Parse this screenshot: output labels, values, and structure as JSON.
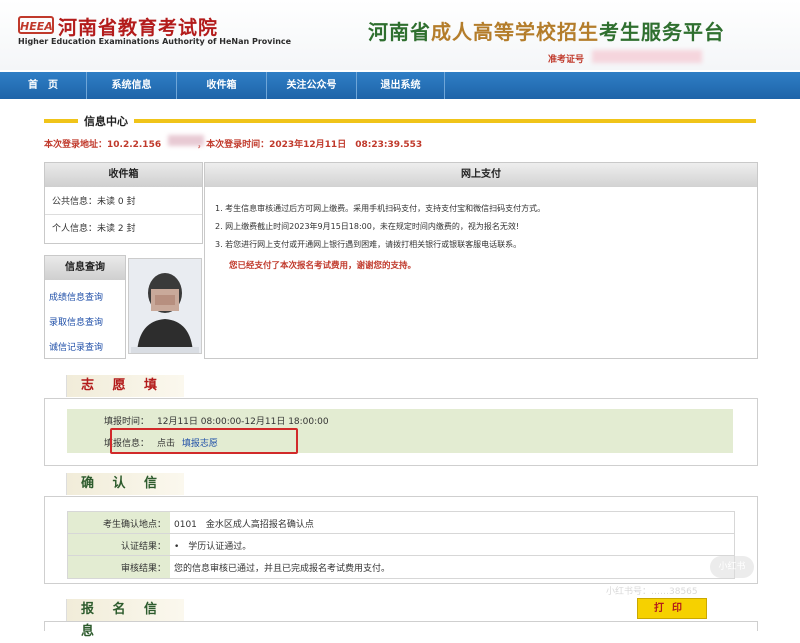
{
  "header": {
    "logo_text": "HEEA",
    "org_name": "河南省教育考试院",
    "org_name_en": "Higher Education Examinations Authority of HeNan Province",
    "platform_title_a": "河南省",
    "platform_title_b": "成人高等学校招生",
    "platform_title_c": "考生服务平台",
    "ticket_label": "准考证号"
  },
  "nav": {
    "items": [
      "首　页",
      "系统信息",
      "收件箱",
      "关注公众号",
      "退出系统"
    ]
  },
  "info_center": {
    "title": "信息中心",
    "login_line": "本次登录地址：10.2.2.156　　　　，本次登录时间：2023年12月11日　08:23:39.553"
  },
  "inbox": {
    "title": "收件箱",
    "public": "公共信息：未读 0 封",
    "personal": "个人信息：未读 2 封"
  },
  "query": {
    "title": "信息查询",
    "links": [
      "成绩信息查询",
      "录取信息查询",
      "诚信记录查询"
    ]
  },
  "payment": {
    "title": "网上支付",
    "lines": [
      "1.  考生信息审核通过后方可网上缴费。采用手机扫码支付，支持支付宝和微信扫码支付方式。",
      "2.  网上缴费截止时间2023年9月15日18:00，未在规定时间内缴费的，视为报名无效!",
      "3.  若您进行网上支付或开通网上银行遇到困难，请拨打相关银行或银联客服电话联系。"
    ],
    "success": "您已经支付了本次报名考试费用，谢谢您的支持。"
  },
  "volunteer": {
    "title": "志 愿 填 报",
    "time_label": "填报时间：",
    "time_value": "12月11日 08:00:00-12月11日 18:00:00",
    "info_label": "填报信息：",
    "info_prefix": "点击",
    "info_link": "填报志愿"
  },
  "confirm": {
    "title": "确 认 信 息",
    "rows": [
      {
        "label": "考生确认地点：",
        "value": "0101　金水区成人高招报名确认点"
      },
      {
        "label": "认证结果：",
        "value": "•　学历认证通过。"
      },
      {
        "label": "审核结果：",
        "value": "您的信息审核已通过，并且已完成报名考试费用支付。"
      }
    ]
  },
  "registration": {
    "title": "报 名 信 息",
    "print_label": "打印"
  },
  "watermark": {
    "badge": "小红书",
    "text": "小红书号：……38565"
  }
}
